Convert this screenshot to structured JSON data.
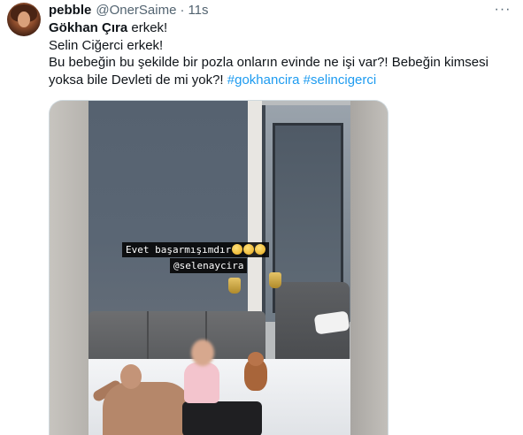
{
  "tweet": {
    "author": {
      "name": "pebble",
      "handle": "@OnerSaime",
      "separator": "·",
      "time": "11s"
    },
    "more_label": "···",
    "text": {
      "line1_bold": "Gökhan Çıra",
      "line1_rest": " erkek!",
      "line2": "Selin Ciğerci erkek!",
      "line3": "Bu bebeğin bu şekilde bir pozla onların evinde ne işi var?! Bebeğin kimsesi",
      "line4_text": "yoksa  bile Devleti de mi yok?! ",
      "hashtag1": "#gokhancira",
      "hashtag_sep": " ",
      "hashtag2": "#selincigerci"
    },
    "media": {
      "caption1": "Evet başarmışımdır",
      "caption2": "@selenaycira"
    }
  },
  "colors": {
    "accent": "#1d9bf0",
    "text": "#0f1419",
    "secondary": "#536471"
  }
}
